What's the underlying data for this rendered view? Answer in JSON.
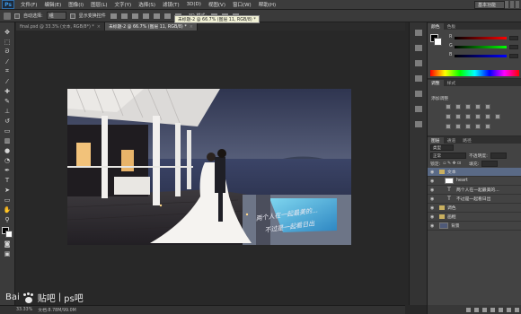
{
  "app": {
    "logo": "Ps"
  },
  "menu": [
    "文件(F)",
    "编辑(E)",
    "图像(I)",
    "图层(L)",
    "文字(Y)",
    "选择(S)",
    "滤镜(T)",
    "3D(D)",
    "视图(V)",
    "窗口(W)",
    "帮助(H)"
  ],
  "workspace": {
    "label": "基本功能"
  },
  "options": {
    "auto_select": "自动选择:",
    "auto_select_value": "组",
    "show_transform": "显示变换控件",
    "mode_3d": "3D 模式:"
  },
  "tabs": [
    {
      "label": "final.psd @ 33.3% (文本, RGB/8*) *"
    },
    {
      "label": "未标题-2 @ 66.7% (图层 11, RGB/8) *"
    }
  ],
  "tooltip": {
    "text": "未标题-2 @ 66.7% (图层 11, RGB/8) *"
  },
  "status": {
    "zoom": "33.33%",
    "doc": "文档:8.78M/99.0M"
  },
  "watermark": {
    "brand": "Bai",
    "brand2": "贴吧",
    "sep": "|",
    "forum": "ps吧"
  },
  "photo": {
    "handwriting_line1": "两个人在一起最美的...",
    "handwriting_line2": "不过是一起看日出"
  },
  "panels": {
    "color_tabs": [
      "颜色",
      "色板"
    ],
    "slider_labels": [
      "R",
      "G",
      "B"
    ],
    "adj_tabs": [
      "调整",
      "样式"
    ],
    "adj_title": "添加调整",
    "layer_tabs": [
      "图层",
      "通道",
      "路径"
    ],
    "kind_label": "类型",
    "blend_mode": "正常",
    "opacity_label": "不透明度:",
    "lock_label": "锁定:",
    "fill_label": "填充:",
    "layers": [
      {
        "name": "文本",
        "kind": "folder",
        "selected": true
      },
      {
        "name": "heart",
        "kind": "image"
      },
      {
        "name": "两个人在一起最美的...",
        "kind": "text"
      },
      {
        "name": "不过是一起看日出",
        "kind": "text"
      },
      {
        "name": "调色",
        "kind": "folder"
      },
      {
        "name": "画框",
        "kind": "folder"
      },
      {
        "name": "背景",
        "kind": "image"
      }
    ]
  }
}
